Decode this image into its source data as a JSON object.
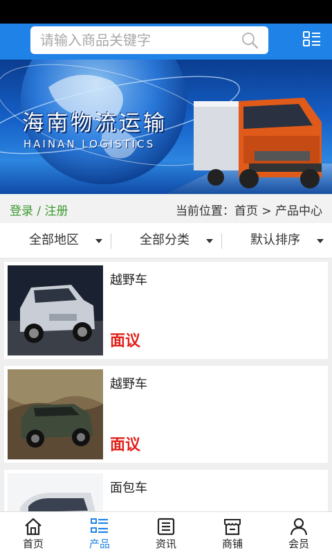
{
  "search": {
    "placeholder": "请输入商品关键字"
  },
  "banner": {
    "title": "海南物流运输",
    "subtitle": "HAINAN LOGISTICS"
  },
  "info": {
    "login": "登录 / 注册",
    "breadcrumb": "当前位置：首页 > 产品中心"
  },
  "filters": [
    {
      "label": "全部地区"
    },
    {
      "label": "全部分类"
    },
    {
      "label": "默认排序"
    }
  ],
  "products": [
    {
      "name": "越野车",
      "price": "面议"
    },
    {
      "name": "越野车",
      "price": "面议"
    },
    {
      "name": "面包车",
      "price": ""
    }
  ],
  "tabs": [
    {
      "label": "首页",
      "icon": "home-icon"
    },
    {
      "label": "产品",
      "icon": "list-icon",
      "active": true
    },
    {
      "label": "资讯",
      "icon": "news-icon"
    },
    {
      "label": "商铺",
      "icon": "shop-icon"
    },
    {
      "label": "会员",
      "icon": "user-icon"
    }
  ],
  "colors": {
    "accent": "#1e82e6",
    "price": "#e0201b",
    "login": "#3a9a2e"
  }
}
